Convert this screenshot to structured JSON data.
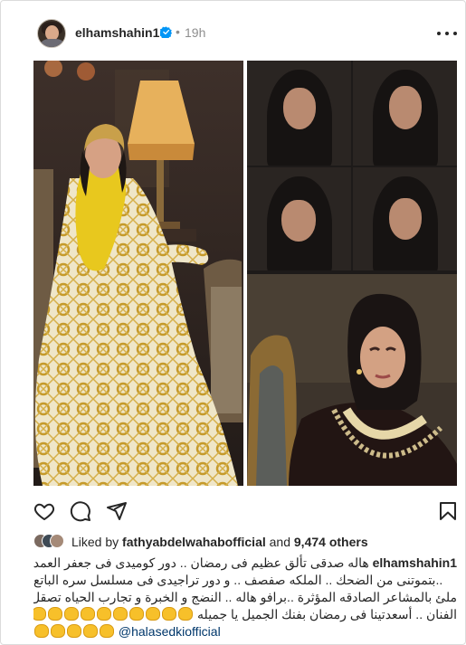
{
  "header": {
    "username": "elhamshahin1",
    "separator": "•",
    "time": "19h"
  },
  "likes": {
    "prefix": "Liked by",
    "liker": "fathyabdelwahabofficial",
    "conjunction": "and",
    "others": "9,474 others"
  },
  "caption": {
    "author": "elhamshahin1",
    "line1": "هاله صدقى تألق عظيم فى رمضان .. دور كوميدى فى جعفر العمدة",
    "line2": "..بتموتنى من الضحك .. الملكه صفصف .. و دور تراجيدى فى مسلسل سره الباتع",
    "line3": "ملئ بالمشاعر الصادقه المؤثرة ..برافو هاله .. النضج و الخبرة و تجارب الحياه تصقل",
    "line4": "الفنان .. أسعدتينا فى رمضان بفنك الجميل يا جميله",
    "mention": "@halasedkiofficial"
  },
  "icons": {
    "verified": "verified-badge-icon",
    "more": "more-options-icon",
    "like": "heart-icon",
    "comment": "comment-icon",
    "share": "send-icon",
    "save": "bookmark-icon",
    "clap": "clapping-hands-emoji"
  },
  "colors": {
    "text": "#262626",
    "secondary": "#8e8e8e",
    "verified": "#0095f6",
    "link": "#00376b"
  }
}
